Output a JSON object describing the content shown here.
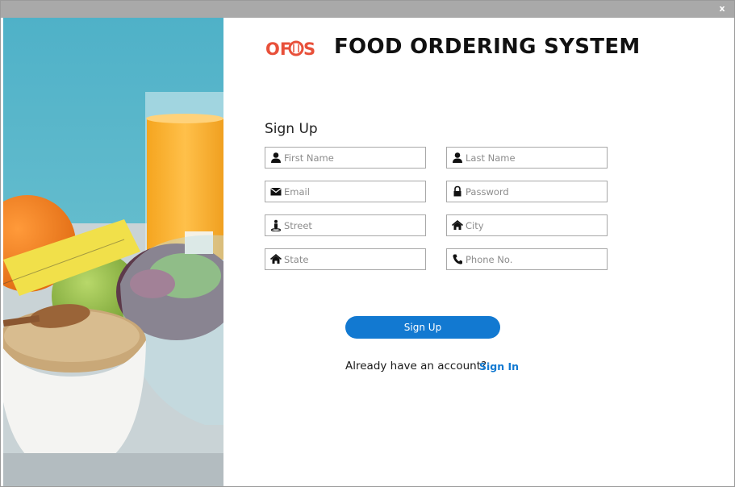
{
  "window": {
    "close_label": "x"
  },
  "brand": {
    "logo_text": "OFOS",
    "title": "FOOD ORDERING SYSTEM",
    "logo_color": "#e8503a"
  },
  "form": {
    "heading": "Sign Up",
    "fields": {
      "first_name": {
        "placeholder": "First Name",
        "icon": "user-icon"
      },
      "last_name": {
        "placeholder": "Last Name",
        "icon": "user-icon"
      },
      "email": {
        "placeholder": "Email",
        "icon": "envelope-icon"
      },
      "password": {
        "placeholder": "Password",
        "icon": "lock-icon"
      },
      "street": {
        "placeholder": "Street",
        "icon": "street-view-icon"
      },
      "city": {
        "placeholder": "City",
        "icon": "home-icon"
      },
      "state": {
        "placeholder": "State",
        "icon": "home-icon"
      },
      "phone": {
        "placeholder": "Phone No.",
        "icon": "phone-icon"
      }
    },
    "submit_label": "Sign Up",
    "account_prompt": "Already have an account?",
    "signin_label": "Sign In"
  },
  "colors": {
    "accent": "#1279d1",
    "titlebar": "#a9a9a9",
    "field_border": "#a8a8a8"
  },
  "images": {
    "side_photo": "food-photo-salad-juice-oats"
  }
}
